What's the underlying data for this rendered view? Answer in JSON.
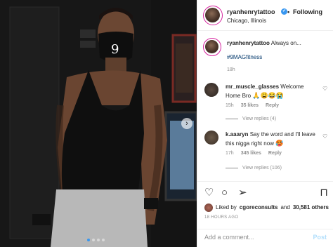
{
  "post": {
    "username": "ryanhenrytattoo",
    "verified_glyph": "✔",
    "follow_label": "Following",
    "separator": "•",
    "location": "Chicago, Illinois",
    "caption_text": "Always on...",
    "hashtag": "#9MAGfitness",
    "caption_time": "18h",
    "photo_nav_next": "›",
    "photo_dots": 4
  },
  "comments": [
    {
      "username": "mr_muscle_glasses",
      "text": "Welcome Home Bro",
      "emojis": "🙏😩😂😭",
      "time": "15h",
      "likes": "35 likes",
      "reply": "Reply",
      "view_replies": "View replies (4)"
    },
    {
      "username": "k.aaaryn",
      "text": "Say the word and I'll leave this nigga right now",
      "emojis": "🥵",
      "time": "17h",
      "likes": "345 likes",
      "reply": "Reply",
      "view_replies": "View replies (106)"
    }
  ],
  "actions": {
    "like_icon": "heart-icon",
    "comment_icon": "comment-icon",
    "share_icon": "share-icon",
    "save_icon": "bookmark-icon"
  },
  "likes": {
    "prefix": "Liked by",
    "user": "cgoreconsults",
    "suffix": "and",
    "count": "30,581 others"
  },
  "post_age": "18 HOURS AGO",
  "comment_box": {
    "placeholder": "Add a comment...",
    "post_label": "Post"
  },
  "colors": {
    "accent": "#3897f0",
    "muted": "#8e8e8e",
    "hashtag": "#00376b"
  }
}
